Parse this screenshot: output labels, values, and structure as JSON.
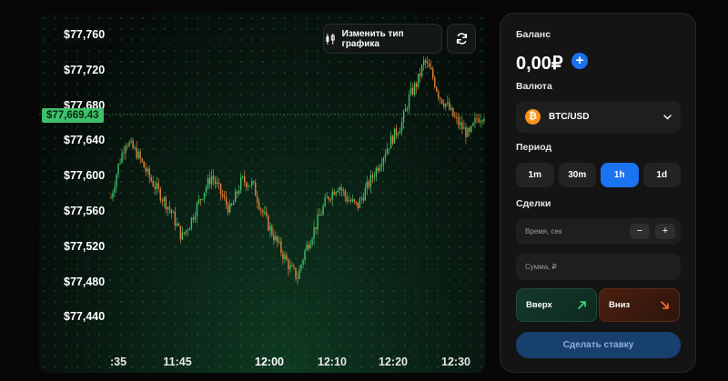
{
  "chart": {
    "y_ticks": [
      "$77,760",
      "$77,720",
      "$77,680",
      "$77,640",
      "$77,600",
      "$77,560",
      "$77,520",
      "$77,480",
      "$77,440"
    ],
    "x_ticks": [
      ":35",
      "11:45",
      "12:00",
      "12:10",
      "12:20",
      "12:30"
    ],
    "current_price": "$77,669.43",
    "change_type_label": "Изменить тип графика",
    "colors": {
      "up": "#3fbf6a",
      "down": "#e0833a",
      "price_line": "#3fbf6a"
    }
  },
  "chart_data": {
    "type": "candlestick",
    "ylim": [
      77430,
      77775
    ],
    "x_ticks": [
      ":35",
      "11:45",
      "12:00",
      "12:10",
      "12:20",
      "12:30"
    ],
    "current_price": 77669.43,
    "close_trace": [
      [
        0,
        77575
      ],
      [
        0.02,
        77612
      ],
      [
        0.04,
        77640
      ],
      [
        0.07,
        77625
      ],
      [
        0.1,
        77600
      ],
      [
        0.13,
        77580
      ],
      [
        0.16,
        77560
      ],
      [
        0.19,
        77530
      ],
      [
        0.21,
        77545
      ],
      [
        0.24,
        77575
      ],
      [
        0.27,
        77600
      ],
      [
        0.3,
        77575
      ],
      [
        0.32,
        77560
      ],
      [
        0.35,
        77595
      ],
      [
        0.38,
        77590
      ],
      [
        0.4,
        77565
      ],
      [
        0.42,
        77545
      ],
      [
        0.45,
        77520
      ],
      [
        0.48,
        77495
      ],
      [
        0.5,
        77485
      ],
      [
        0.52,
        77515
      ],
      [
        0.55,
        77545
      ],
      [
        0.58,
        77575
      ],
      [
        0.61,
        77590
      ],
      [
        0.63,
        77575
      ],
      [
        0.66,
        77565
      ],
      [
        0.69,
        77590
      ],
      [
        0.72,
        77615
      ],
      [
        0.75,
        77640
      ],
      [
        0.78,
        77660
      ],
      [
        0.8,
        77690
      ],
      [
        0.82,
        77705
      ],
      [
        0.84,
        77730
      ],
      [
        0.86,
        77715
      ],
      [
        0.88,
        77690
      ],
      [
        0.9,
        77680
      ],
      [
        0.92,
        77665
      ],
      [
        0.94,
        77655
      ],
      [
        0.96,
        77645
      ],
      [
        0.98,
        77665
      ],
      [
        1.0,
        77670
      ]
    ]
  },
  "sidebar": {
    "balance_label": "Баланс",
    "balance_value": "0,00₽",
    "add_icon": "+",
    "currency_label": "Валюта",
    "currency_icon": "₿",
    "currency_value": "BTC/USD",
    "period_label": "Период",
    "periods": [
      "1m",
      "30m",
      "1h",
      "1d"
    ],
    "active_period": "1h",
    "deals_label": "Сделки",
    "time_placeholder": "Время, сек",
    "minus": "−",
    "plus": "+",
    "amount_placeholder": "Сумма, ₽",
    "up_label": "Вверх",
    "down_label": "Вниз",
    "bet_label": "Сделать ставку",
    "colors": {
      "accent": "#1a73f0",
      "up": "#3ddc84",
      "down": "#ff6a3a"
    }
  }
}
